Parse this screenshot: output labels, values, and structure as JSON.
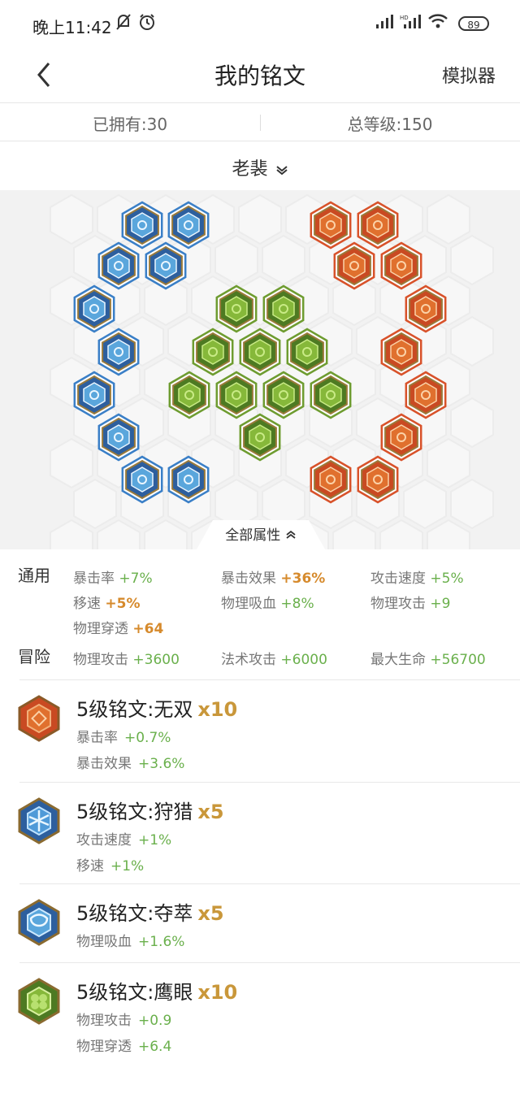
{
  "status_bar": {
    "time": "晚上11:42",
    "battery": "89"
  },
  "nav": {
    "title": "我的铭文",
    "simulator": "模拟器"
  },
  "summary": {
    "owned": "已拥有:30",
    "total_level": "总等级:150"
  },
  "page_selector": {
    "selected": "老裴"
  },
  "all_attributes_toggle": "全部属性",
  "colors": {
    "blue": "#3c7ec8",
    "red": "#d8522a",
    "green": "#6e9c30",
    "gold": "#c9973a",
    "value_green": "#6ab04c"
  },
  "attributes": {
    "general_label": "通用",
    "general": [
      {
        "name": "暴击率",
        "value": "+7%"
      },
      {
        "name": "暴击效果",
        "value": "+36%",
        "emphasis": true
      },
      {
        "name": "攻击速度",
        "value": "+5%"
      },
      {
        "name": "移速",
        "value": "+5%",
        "emphasis": true
      },
      {
        "name": "物理吸血",
        "value": "+8%"
      },
      {
        "name": "物理攻击",
        "value": "+9"
      },
      {
        "name": "物理穿透",
        "value": "+64",
        "emphasis": true
      }
    ],
    "adventure_label": "冒险",
    "adventure": [
      {
        "name": "物理攻击",
        "value": "+3600"
      },
      {
        "name": "法术攻击",
        "value": "+6000"
      },
      {
        "name": "最大生命",
        "value": "+56700"
      }
    ]
  },
  "inscriptions": [
    {
      "name": "5级铭文:无双",
      "count": "x10",
      "color": "red",
      "stats": [
        {
          "name": "暴击率",
          "value": "+0.7%"
        },
        {
          "name": "暴击效果",
          "value": "+3.6%"
        }
      ]
    },
    {
      "name": "5级铭文:狩猎",
      "count": "x5",
      "color": "blue",
      "stats": [
        {
          "name": "攻击速度",
          "value": "+1%"
        },
        {
          "name": "移速",
          "value": "+1%"
        }
      ]
    },
    {
      "name": "5级铭文:夺萃",
      "count": "x5",
      "color": "blue2",
      "stats": [
        {
          "name": "物理吸血",
          "value": "+1.6%"
        }
      ]
    },
    {
      "name": "5级铭文:鹰眼",
      "count": "x10",
      "color": "green",
      "stats": [
        {
          "name": "物理攻击",
          "value": "+0.9"
        },
        {
          "name": "物理穿透",
          "value": "+6.4"
        }
      ]
    }
  ]
}
